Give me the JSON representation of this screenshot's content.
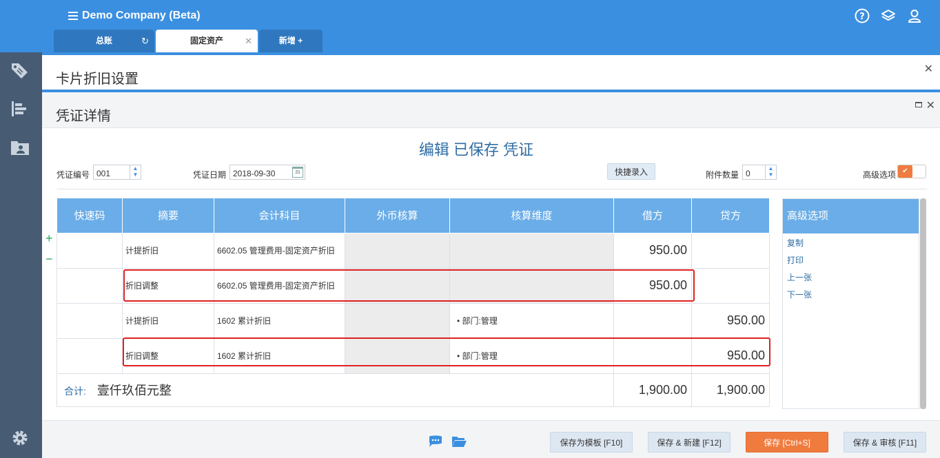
{
  "app": {
    "company": "Demo Company (Beta)"
  },
  "tabs": [
    {
      "label": "总账",
      "icon": "refresh-icon"
    },
    {
      "label": "固定资产",
      "icon": "close-icon"
    },
    {
      "label": "新增 +",
      "icon": ""
    }
  ],
  "bg_panel": {
    "title": "卡片折旧设置"
  },
  "dialog": {
    "title": "凭证详情",
    "heading": "编辑 已保存 凭证",
    "fields": {
      "voucher_no_label": "凭证编号",
      "voucher_no": "001",
      "voucher_date_label": "凭证日期",
      "voucher_date": "2018-09-30",
      "quick_entry": "快捷录入",
      "attachments_label": "附件数量",
      "attachments": "0",
      "advanced_label": "高级选项"
    },
    "table": {
      "headers": [
        "快速码",
        "摘要",
        "会计科目",
        "外币核算",
        "核算维度",
        "借方",
        "贷方"
      ],
      "rows": [
        {
          "code": "",
          "summary": "计提折旧",
          "account": "6602.05 管理费用-固定资产折旧",
          "fx": "",
          "dimension": "",
          "debit": "950.00",
          "credit": ""
        },
        {
          "code": "",
          "summary": "折旧调整",
          "account": "6602.05 管理费用-固定资产折旧",
          "fx": "",
          "dimension": "",
          "debit": "950.00",
          "credit": ""
        },
        {
          "code": "",
          "summary": "计提折旧",
          "account": "1602 累计折旧",
          "fx": "",
          "dimension": "• 部门:管理",
          "debit": "",
          "credit": "950.00"
        },
        {
          "code": "",
          "summary": "折旧调整",
          "account": "1602 累计折旧",
          "fx": "",
          "dimension": "• 部门:管理",
          "debit": "",
          "credit": "950.00"
        }
      ],
      "total": {
        "label": "合计:",
        "amount_words": "壹仟玖佰元整",
        "debit": "1,900.00",
        "credit": "1,900.00"
      }
    },
    "advanced": {
      "title": "高级选项",
      "links": [
        "复制",
        "打印",
        "上一张",
        "下一张"
      ]
    },
    "buttons": {
      "save_template": "保存为模板 [F10]",
      "save_new": "保存 & 新建 [F12]",
      "save": "保存 [Ctrl+S]",
      "save_review": "保存 & 审核 [F11]"
    }
  },
  "colors": {
    "primary": "#3b8fe0",
    "header": "#6aade8",
    "accent": "#f07b3f",
    "highlight": "#e02020"
  }
}
